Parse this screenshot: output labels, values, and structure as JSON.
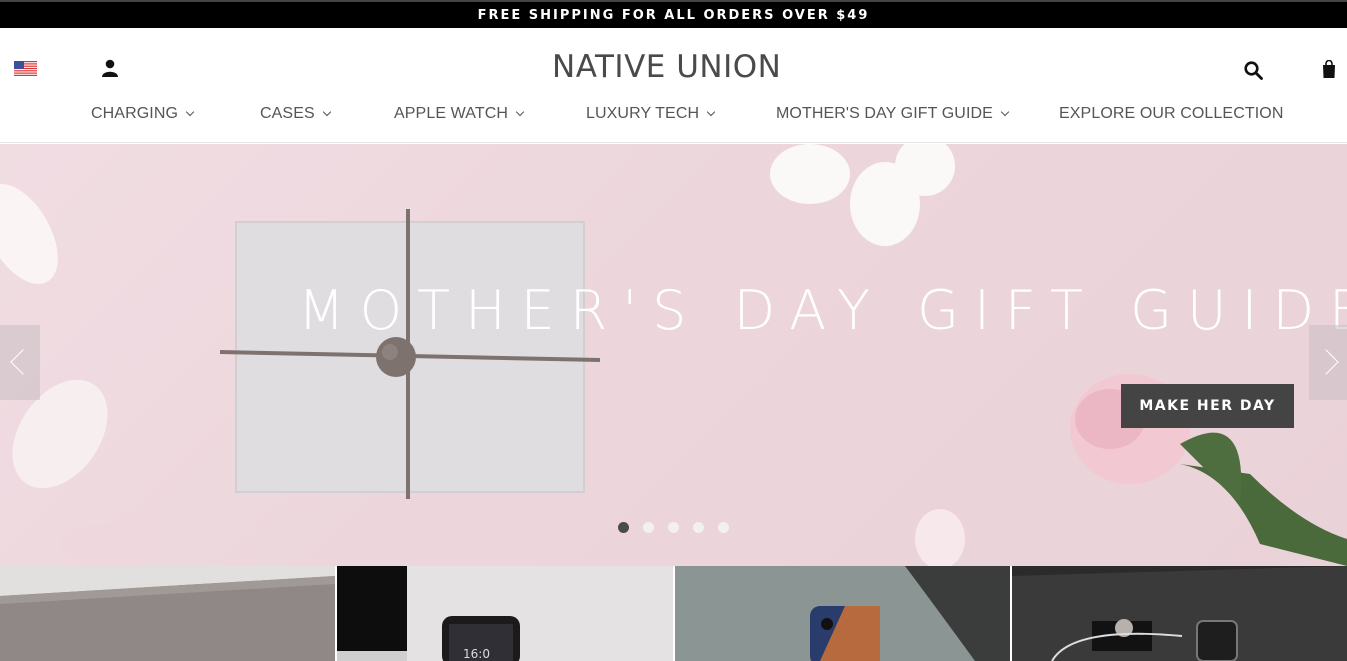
{
  "topbar": {
    "text": "FREE SHIPPING FOR ALL ORDERS OVER $49"
  },
  "header": {
    "logo": "NATIVE UNION",
    "icons": {
      "flag": "us-flag-icon",
      "account": "account-icon",
      "search": "search-icon",
      "bag": "shopping-bag-icon"
    }
  },
  "nav": {
    "items": [
      {
        "label": "CHARGING"
      },
      {
        "label": "CASES"
      },
      {
        "label": "APPLE WATCH"
      },
      {
        "label": "LUXURY TECH"
      },
      {
        "label": "MOTHER'S DAY GIFT GUIDE"
      },
      {
        "label": "EXPLORE OUR COLLECTION"
      }
    ]
  },
  "hero": {
    "title": "MOTHER'S DAY GIFT GUIDE",
    "cta": "MAKE HER DAY",
    "slides_count": 5,
    "active_slide": 1
  },
  "tiles": {
    "count": 4
  },
  "colors": {
    "topbar": "#000000",
    "cta": "#444444",
    "hero_bg": "#ecd6dc"
  }
}
